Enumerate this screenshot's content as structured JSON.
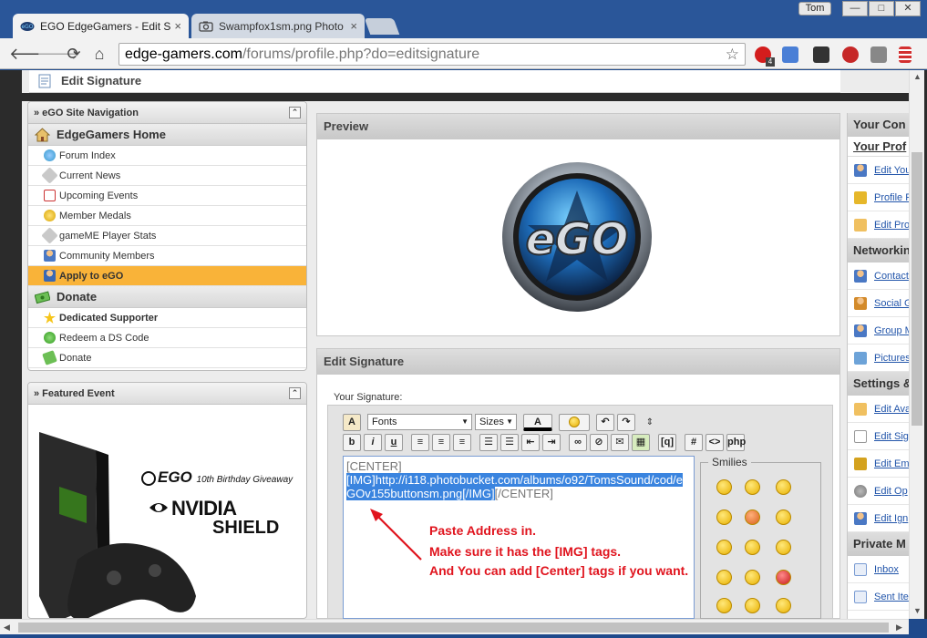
{
  "browser": {
    "tabs": [
      {
        "title": "EGO EdgeGamers - Edit Si",
        "close": "×"
      },
      {
        "title": "Swampfox1sm.png Photo",
        "close": "×"
      }
    ],
    "user": "Tom",
    "window_controls": {
      "minimize": "—",
      "maximize": "□",
      "close": "✕"
    },
    "nav": {
      "back": "🡐",
      "forward": "🡒",
      "reload": "⟳",
      "home": "⌂"
    },
    "url_host": "edge-gamers.com",
    "url_path": "/forums/profile.php?do=editsignature",
    "star": "☆",
    "ext_badge": "4"
  },
  "page": {
    "breadcrumb_title": "Edit Signature",
    "site_nav": {
      "title": "» eGO Site Navigation",
      "collapse": "⌃",
      "sections": [
        {
          "title": "EdgeGamers Home",
          "items": [
            "Forum Index",
            "Current News",
            "Upcoming Events",
            "Member Medals",
            "gameME Player Stats",
            "Community Members",
            "Apply to eGO"
          ]
        },
        {
          "title": "Donate",
          "items": [
            "Dedicated Supporter",
            "Redeem a DS Code",
            "Donate"
          ]
        }
      ]
    },
    "featured": {
      "title": "» Featured Event",
      "collapse": "⌃",
      "ego_brand": "EGO",
      "ego_tag": "10th Birthday Giveaway",
      "nvidia": "NVIDIA",
      "shield": "SHIELD"
    },
    "preview": {
      "title": "Preview"
    },
    "edit_signature": {
      "title": "Edit Signature",
      "your_signature": "Your Signature:",
      "fonts_label": "Fonts",
      "sizes_label": "Sizes",
      "btn_bold": "b",
      "btn_italic": "i",
      "btn_underline": "u",
      "btn_quote": "[q]",
      "btn_hash": "#",
      "btn_code": "<>",
      "text_line1": "[CENTER]",
      "text_selected": "[IMG]http://i118.photobucket.com/albums/o92/TomsSound/cod/eGOv155buttonsm.png[/IMG]",
      "text_tail": "[/CENTER]",
      "smilies_label": "Smilies"
    },
    "annotation": [
      "Paste Address in.",
      "Make sure it has the [IMG] tags.",
      "And You can add [Center] tags if you want."
    ],
    "right_column": {
      "title": "Your Con",
      "sub1": "Your Prof",
      "items1": [
        "Edit You",
        "Profile P",
        "Edit Pro"
      ],
      "h_networking": "Networkin",
      "items2": [
        "Contact",
        "Social G",
        "Group M",
        "Pictures"
      ],
      "h_settings": "Settings &",
      "items3": [
        "Edit Ava",
        "Edit Sig",
        "Edit Em",
        "Edit Op",
        "Edit Ign"
      ],
      "h_private": "Private M",
      "items4": [
        "Inbox",
        "Sent Ite"
      ]
    }
  },
  "colors": {
    "chrome": "#2a5699",
    "highlight": "#f9b339",
    "annotation": "#e0141e",
    "selection": "#3a84df"
  }
}
